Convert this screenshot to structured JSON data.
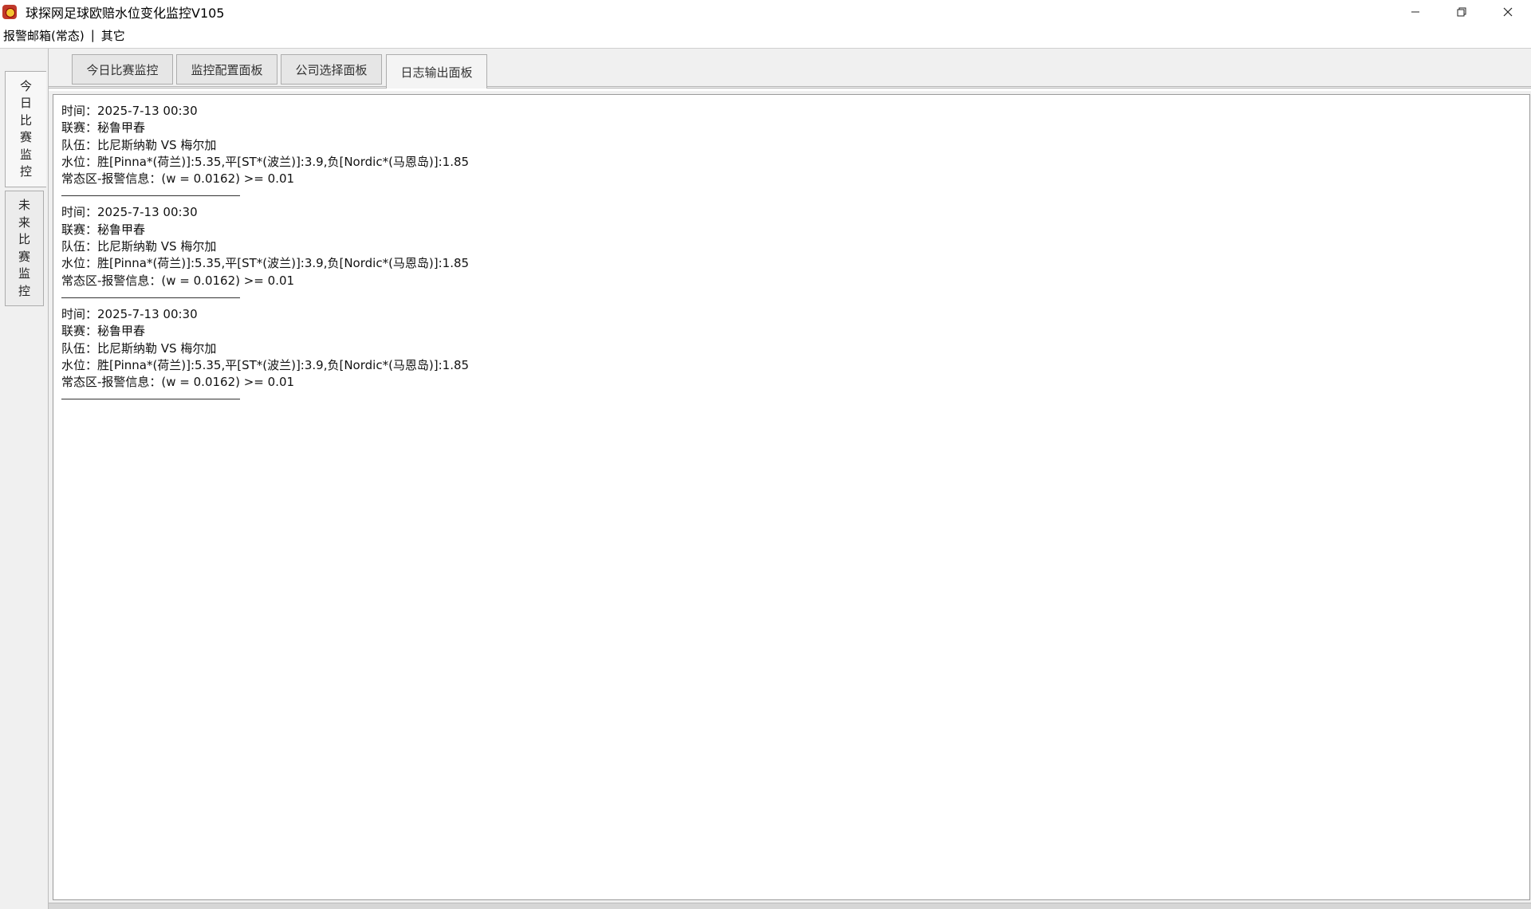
{
  "window": {
    "title": "球探网足球欧赔水位变化监控V105",
    "app_icon": "app-logo-icon",
    "controls": [
      "minimize-icon",
      "restore-icon",
      "close-icon"
    ]
  },
  "menu": {
    "items": [
      {
        "label": "报警邮箱(常态)"
      },
      {
        "separator": "|"
      },
      {
        "label": "其它"
      }
    ]
  },
  "side_tabs": [
    {
      "chars": [
        "今",
        "日",
        "比",
        "赛",
        "监",
        "控"
      ],
      "active": true
    },
    {
      "chars": [
        "未",
        "来",
        "比",
        "赛",
        "监",
        "控"
      ],
      "active": false
    }
  ],
  "top_tabs": [
    {
      "label": "今日比赛监控",
      "active": false
    },
    {
      "label": "监控配置面板",
      "active": false
    },
    {
      "label": "公司选择面板",
      "active": false
    },
    {
      "label": "日志输出面板",
      "active": true
    }
  ],
  "log": {
    "entries": [
      {
        "lines": [
          "时间：2025-7-13 00:30",
          "联赛：秘鲁甲春",
          "队伍：比尼斯纳勒 VS 梅尔加",
          "水位：胜[Pinna*(荷兰)]:5.35,平[ST*(波兰)]:3.9,负[Nordic*(马恩岛)]:1.85",
          "常态区-报警信息：(w = 0.0162) >= 0.01"
        ]
      },
      {
        "lines": [
          "时间：2025-7-13 00:30",
          "联赛：秘鲁甲春",
          "队伍：比尼斯纳勒 VS 梅尔加",
          "水位：胜[Pinna*(荷兰)]:5.35,平[ST*(波兰)]:3.9,负[Nordic*(马恩岛)]:1.85",
          "常态区-报警信息：(w = 0.0162) >= 0.01"
        ]
      },
      {
        "lines": [
          "时间：2025-7-13 00:30",
          "联赛：秘鲁甲春",
          "队伍：比尼斯纳勒 VS 梅尔加",
          "水位：胜[Pinna*(荷兰)]:5.35,平[ST*(波兰)]:3.9,负[Nordic*(马恩岛)]:1.85",
          "常态区-报警信息：(w = 0.0162) >= 0.01"
        ]
      }
    ]
  }
}
